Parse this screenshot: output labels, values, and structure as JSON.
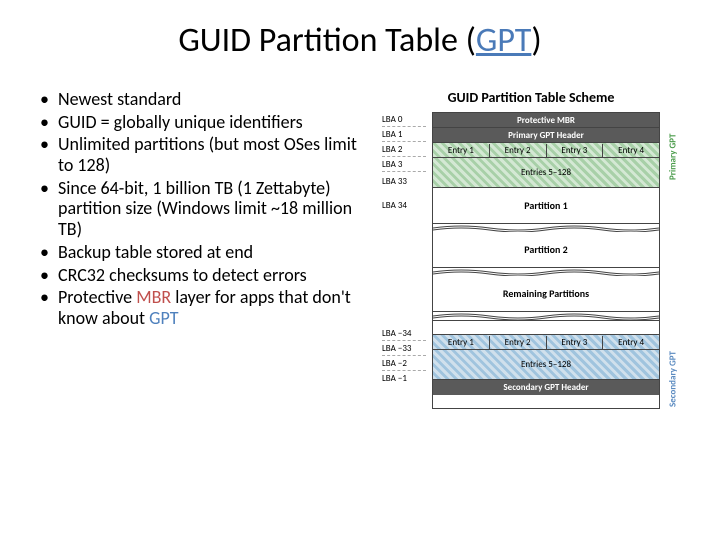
{
  "title": {
    "prefix": "GUID Partition Table (",
    "link": "GPT",
    "suffix": ")"
  },
  "bullets": [
    "Newest standard",
    "GUID = globally unique identifiers",
    "Unlimited partitions (but most OSes limit to 128)",
    "Since 64-bit, 1 billion TB (1 Zettabyte) partition size (Windows limit ~18 million TB)",
    "Backup table stored at end",
    "CRC32 checksums to detect errors"
  ],
  "bullet7": {
    "prefix": "Protective ",
    "mbr": "MBR",
    "mid": " layer for apps that don't know about ",
    "gpt": "GPT"
  },
  "diagram": {
    "title": "GUID Partition Table Scheme",
    "lba": {
      "l0": "LBA 0",
      "l1": "LBA 1",
      "l2": "LBA 2",
      "l3": "LBA 3",
      "l33": "LBA 33",
      "l34": "LBA 34",
      "ln34": "LBA −34",
      "ln33": "LBA −33",
      "ln2": "LBA −2",
      "ln1": "LBA −1"
    },
    "rows": {
      "protective_mbr": "Protective MBR",
      "primary_header": "Primary GPT Header",
      "e1": "Entry 1",
      "e2": "Entry 2",
      "e3": "Entry 3",
      "e4": "Entry 4",
      "entries_5_128": "Entries 5–128",
      "partition1": "Partition 1",
      "partition2": "Partition 2",
      "remaining": "Remaining Partitions",
      "secondary_header": "Secondary GPT Header"
    },
    "side": {
      "primary": "Primary GPT",
      "secondary": "Secondary GPT"
    }
  }
}
